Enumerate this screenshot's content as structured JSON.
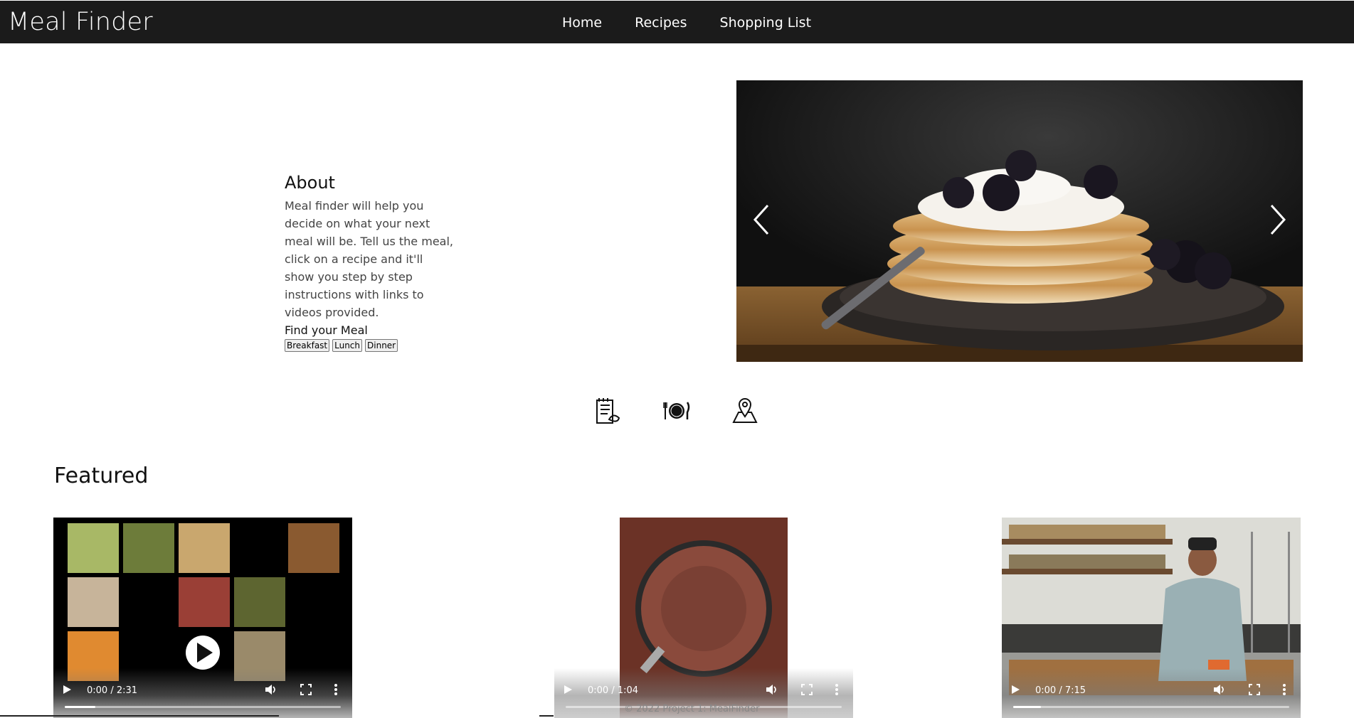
{
  "header": {
    "brand": "Meal Finder",
    "nav": [
      "Home",
      "Recipes",
      "Shopping List"
    ]
  },
  "about": {
    "title": "About",
    "text": "Meal finder will help you decide on what your next meal will be. Tell us the meal, click on a recipe and it'll show you step by step instructions with links to videos provided.",
    "find_title": "Find your Meal",
    "buttons": [
      "Breakfast",
      "Lunch",
      "Dinner"
    ]
  },
  "carousel": {
    "slide": "pancakes-with-blackberries-photo"
  },
  "features": {
    "icons": [
      "recipe-list-icon",
      "plate-fork-knife-icon",
      "map-pin-icon"
    ]
  },
  "featured": {
    "title": "Featured",
    "videos": [
      {
        "time": "0:00 / 2:31",
        "progress": 0.11
      },
      {
        "time": "0:00 / 1:04",
        "progress": 0.0
      },
      {
        "time": "0:00 / 7:15",
        "progress": 0.1
      }
    ]
  },
  "footer": {
    "text": "© 2022 Project 1: MealFinder"
  },
  "colors": {
    "navbar": "#1b1b1b",
    "accent_text": "#ffffff"
  }
}
